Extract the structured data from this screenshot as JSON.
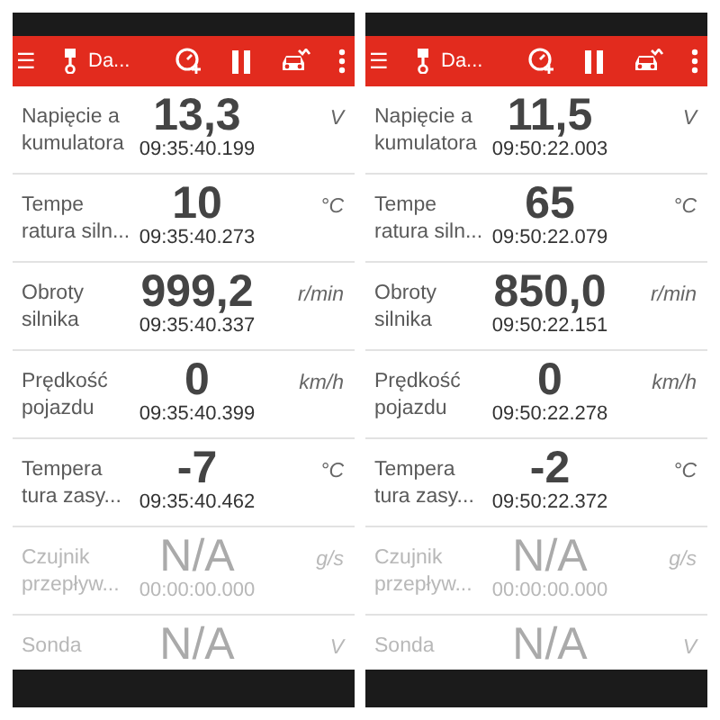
{
  "screens": [
    {
      "toolbar": {
        "menu": "☰",
        "title": "Da..."
      },
      "rows": [
        {
          "label_lines": [
            "Napięcie a",
            "kumulatora"
          ],
          "value": "13,3",
          "time": "09:35:40.199",
          "unit": "V",
          "disabled": false
        },
        {
          "label_lines": [
            "Tempe",
            "ratura siln..."
          ],
          "value": "10",
          "time": "09:35:40.273",
          "unit": "°C",
          "disabled": false
        },
        {
          "label_lines": [
            "Obroty",
            "silnika"
          ],
          "value": "999,2",
          "time": "09:35:40.337",
          "unit": "r/min",
          "disabled": false
        },
        {
          "label_lines": [
            "Prędkość",
            "pojazdu"
          ],
          "value": "0",
          "time": "09:35:40.399",
          "unit": "km/h",
          "disabled": false
        },
        {
          "label_lines": [
            "Tempera",
            "tura zasy..."
          ],
          "value": "-7",
          "time": "09:35:40.462",
          "unit": "°C",
          "disabled": false
        },
        {
          "label_lines": [
            "Czujnik",
            "przepływ..."
          ],
          "value": "N/A",
          "time": "00:00:00.000",
          "unit": "g/s",
          "disabled": true
        },
        {
          "label_lines": [
            "Sonda"
          ],
          "value": "N/A",
          "unit": "V",
          "disabled": true
        }
      ]
    },
    {
      "toolbar": {
        "menu": "☰",
        "title": "Da..."
      },
      "rows": [
        {
          "label_lines": [
            "Napięcie a",
            "kumulatora"
          ],
          "value": "11,5",
          "time": "09:50:22.003",
          "unit": "V",
          "disabled": false
        },
        {
          "label_lines": [
            "Tempe",
            "ratura siln..."
          ],
          "value": "65",
          "time": "09:50:22.079",
          "unit": "°C",
          "disabled": false
        },
        {
          "label_lines": [
            "Obroty",
            "silnika"
          ],
          "value": "850,0",
          "time": "09:50:22.151",
          "unit": "r/min",
          "disabled": false
        },
        {
          "label_lines": [
            "Prędkość",
            "pojazdu"
          ],
          "value": "0",
          "time": "09:50:22.278",
          "unit": "km/h",
          "disabled": false
        },
        {
          "label_lines": [
            "Tempera",
            "tura zasy..."
          ],
          "value": "-2",
          "time": "09:50:22.372",
          "unit": "°C",
          "disabled": false
        },
        {
          "label_lines": [
            "Czujnik",
            "przepływ..."
          ],
          "value": "N/A",
          "time": "00:00:00.000",
          "unit": "g/s",
          "disabled": true
        },
        {
          "label_lines": [
            "Sonda"
          ],
          "value": "N/A",
          "unit": "V",
          "disabled": true
        }
      ]
    }
  ]
}
